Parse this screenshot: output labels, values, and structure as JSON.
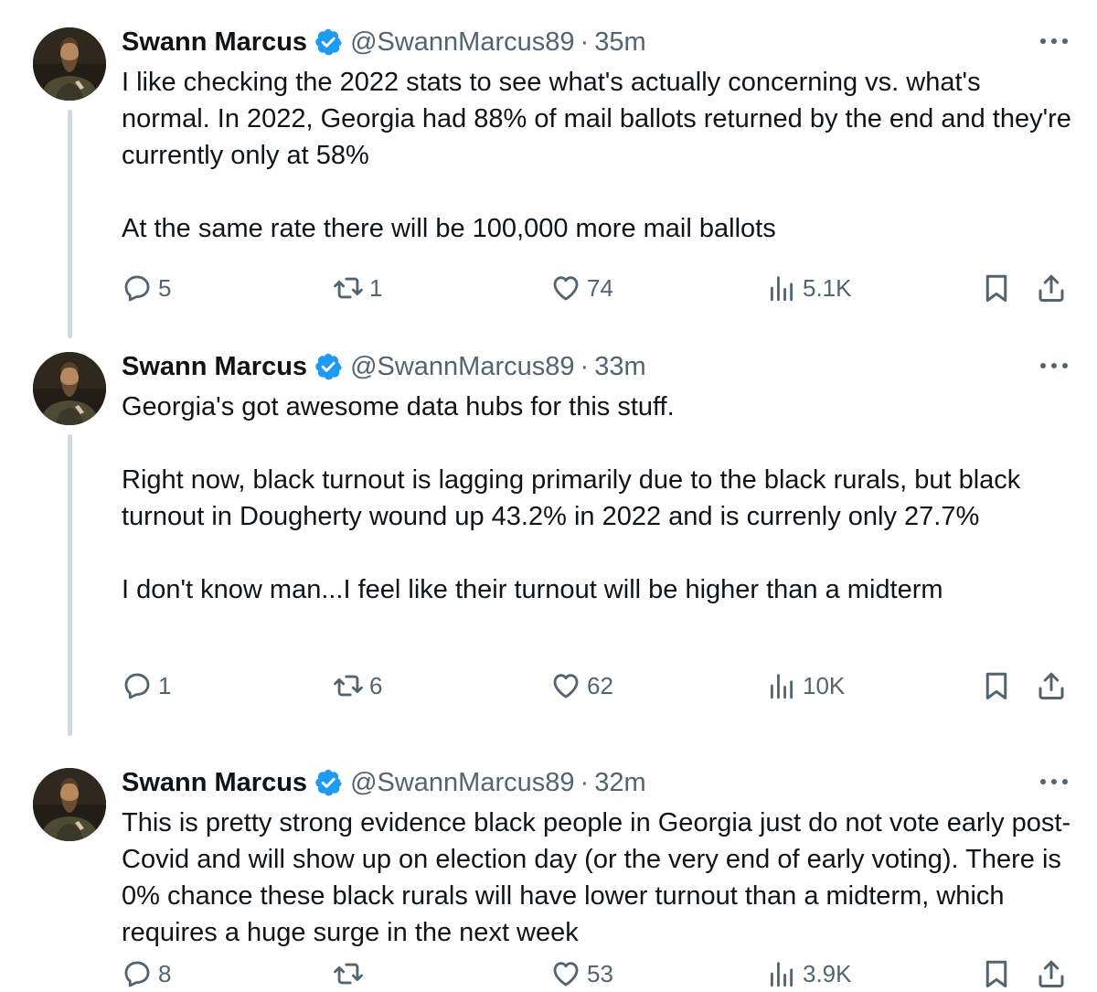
{
  "tweets": [
    {
      "author": {
        "name": "Swann Marcus",
        "handle": "@SwannMarcus89",
        "verified": true,
        "avatar_icon": "portrait-avatar"
      },
      "time": "35m",
      "paragraphs": [
        "I like checking the 2022 stats to see what's actually concerning vs. what's normal. In 2022, Georgia had 88% of mail ballots returned by the end and they're currently only at 58%",
        "At the same rate there will be 100,000 more mail ballots"
      ],
      "stats": {
        "replies": "5",
        "reposts": "1",
        "likes": "74",
        "views": "5.1K"
      }
    },
    {
      "author": {
        "name": "Swann Marcus",
        "handle": "@SwannMarcus89",
        "verified": true,
        "avatar_icon": "portrait-avatar"
      },
      "time": "33m",
      "paragraphs": [
        "Georgia's got awesome data hubs for this stuff.",
        "Right now, black turnout is lagging primarily due to the black rurals, but black turnout in Dougherty wound up 43.2% in 2022 and is currenly only 27.7%",
        "I don't know man...I feel like their turnout will be higher than a midterm"
      ],
      "stats": {
        "replies": "1",
        "reposts": "6",
        "likes": "62",
        "views": "10K"
      }
    },
    {
      "author": {
        "name": "Swann Marcus",
        "handle": "@SwannMarcus89",
        "verified": true,
        "avatar_icon": "portrait-avatar"
      },
      "time": "32m",
      "paragraphs": [
        "This is pretty strong evidence black people in Georgia just do not vote early post-Covid and will show up on election day (or the very end of early voting). There is 0% chance these black rurals will have lower turnout than a midterm, which requires a huge surge in the next week"
      ],
      "stats": {
        "replies": "8",
        "reposts": "",
        "likes": "53",
        "views": "3.9K"
      }
    }
  ],
  "separator": "·",
  "colors": {
    "text": "#0f1419",
    "secondary": "#536471",
    "verified": "#1d9bf0",
    "thread_line": "#cfd9de"
  }
}
